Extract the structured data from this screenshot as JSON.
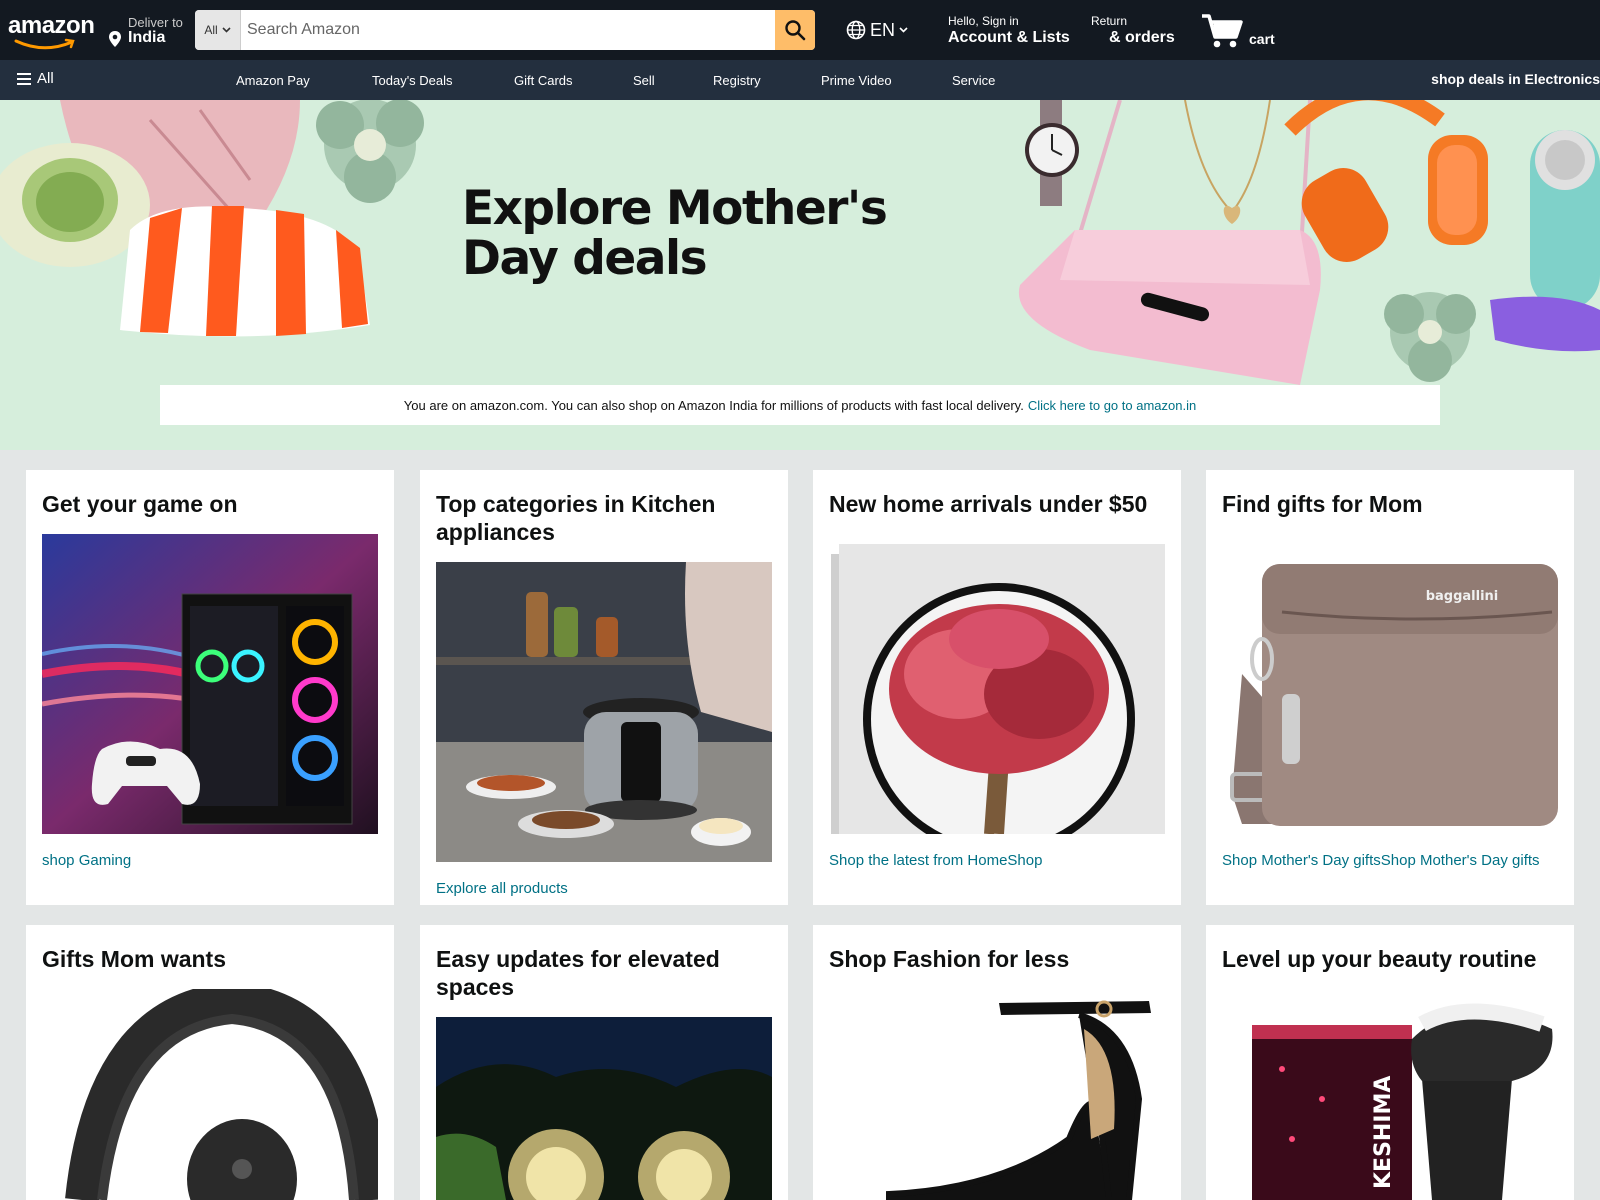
{
  "colors": {
    "nav_bg": "#131921",
    "subnav_bg": "#232f3e",
    "search_button": "#febd69",
    "link": "#007185",
    "hero_bg": "#d6eedc",
    "page_bg": "#e3e6e6"
  },
  "header": {
    "logo_text": "amazon",
    "deliver_line1": "Deliver to",
    "deliver_line2": "India",
    "search_category": "All",
    "search_placeholder": "Search Amazon",
    "language": "EN",
    "account_line1": "Hello, Sign in",
    "account_line2": "Account & Lists",
    "returns_line1": "Return",
    "returns_line2": "& orders",
    "cart_label": "cart"
  },
  "subnav": {
    "all_label": "All",
    "links": [
      "Amazon Pay",
      "Today's Deals",
      "Gift Cards",
      "Sell",
      "Registry",
      "Prime Video",
      "Service"
    ],
    "promo": "shop deals in Electronics"
  },
  "hero": {
    "title_line1": "Explore Mother's",
    "title_line2": "Day deals",
    "notice_text": "You are on amazon.com. You can also shop on Amazon India for millions of products with fast local delivery.",
    "notice_link": "Click here to go to amazon.in",
    "bag_brand": "baggallini"
  },
  "cards": [
    {
      "title": "Get your game on",
      "link": "shop Gaming"
    },
    {
      "title": "Top categories in Kitchen appliances",
      "link": "Explore all products"
    },
    {
      "title": "New home arrivals under $50",
      "link": "Shop the latest from HomeShop"
    },
    {
      "title": "Find gifts for Mom",
      "link": "Shop Mother's Day giftsShop Mother's Day gifts"
    },
    {
      "title": "Gifts Mom wants"
    },
    {
      "title": "Easy updates for elevated spaces"
    },
    {
      "title": "Shop Fashion for less"
    },
    {
      "title": "Level up your beauty routine",
      "product_brand": "KESHIMA"
    }
  ]
}
